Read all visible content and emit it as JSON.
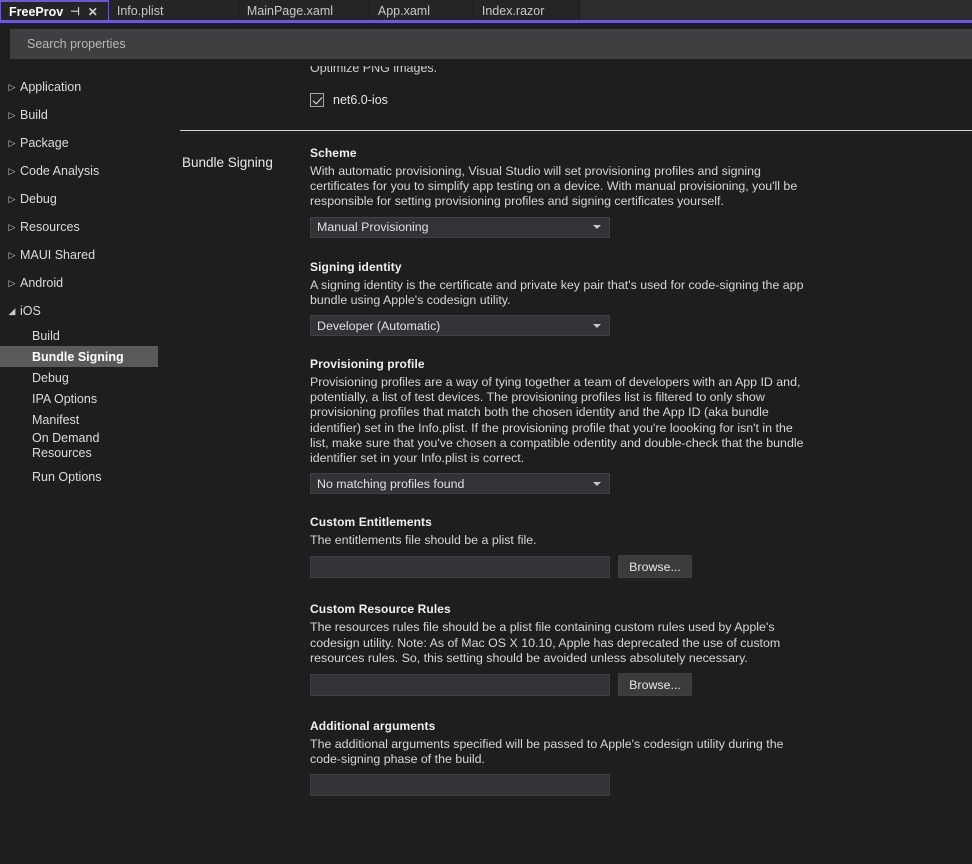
{
  "tabs": [
    {
      "label": "FreeProv",
      "active": true,
      "pin_icon": "pin-icon",
      "close_icon": "close-icon"
    },
    {
      "label": "Info.plist",
      "active": false
    },
    {
      "label": "MainPage.xaml",
      "active": false
    },
    {
      "label": "App.xaml",
      "active": false
    },
    {
      "label": "Index.razor",
      "active": false
    }
  ],
  "search": {
    "placeholder": "Search properties",
    "value": ""
  },
  "sidebar": {
    "items": [
      {
        "label": "Application",
        "expandable": true,
        "expanded": false,
        "level": 0
      },
      {
        "label": "Build",
        "expandable": true,
        "expanded": false,
        "level": 0
      },
      {
        "label": "Package",
        "expandable": true,
        "expanded": false,
        "level": 0
      },
      {
        "label": "Code Analysis",
        "expandable": true,
        "expanded": false,
        "level": 0
      },
      {
        "label": "Debug",
        "expandable": true,
        "expanded": false,
        "level": 0
      },
      {
        "label": "Resources",
        "expandable": true,
        "expanded": false,
        "level": 0
      },
      {
        "label": "MAUI Shared",
        "expandable": true,
        "expanded": false,
        "level": 0
      },
      {
        "label": "Android",
        "expandable": true,
        "expanded": false,
        "level": 0
      },
      {
        "label": "iOS",
        "expandable": true,
        "expanded": true,
        "level": 0
      },
      {
        "label": "Build",
        "level": 1,
        "selected": false
      },
      {
        "label": "Bundle Signing",
        "level": 1,
        "selected": true
      },
      {
        "label": "Debug",
        "level": 1,
        "selected": false
      },
      {
        "label": "IPA Options",
        "level": 1,
        "selected": false
      },
      {
        "label": "Manifest",
        "level": 1,
        "selected": false
      },
      {
        "label": "On Demand Resources",
        "level": 1,
        "selected": false
      },
      {
        "label": "Run Options",
        "level": 1,
        "selected": false
      }
    ]
  },
  "content": {
    "clipped_text": "Optimize PNG images.",
    "framework_checkbox": {
      "label": "net6.0-ios",
      "checked": true
    },
    "section_title": "Bundle Signing",
    "fields": {
      "scheme": {
        "label": "Scheme",
        "description": "With automatic provisioning, Visual Studio will set provisioning profiles and signing certificates for you to simplify app testing on a device. With manual provisioning, you'll be responsible for setting provisioning profiles and signing certificates yourself.",
        "value": "Manual Provisioning"
      },
      "signing_identity": {
        "label": "Signing identity",
        "description": "A signing identity is the certificate and private key pair that's used for code-signing the app bundle using Apple's codesign utility.",
        "value": "Developer (Automatic)"
      },
      "provisioning_profile": {
        "label": "Provisioning profile",
        "description": "Provisioning profiles are a way of tying together a team of developers with an App ID and, potentially, a list of test devices. The provisioning profiles list is filtered to only show provisioning profiles that match both the chosen identity and the App ID (aka bundle identifier) set in the Info.plist. If the provisioning profile that you're loooking for isn't in the list, make sure that you've chosen a compatible odentity and double-check that the bundle identifier set in your Info.plist is correct.",
        "value": "No matching profiles found"
      },
      "custom_entitlements": {
        "label": "Custom Entitlements",
        "description": "The entitlements file should be a plist file.",
        "value": "",
        "browse_label": "Browse..."
      },
      "custom_resource_rules": {
        "label": "Custom Resource Rules",
        "description": "The resources rules file should be a plist file containing custom rules used by Apple's codesign utility. Note: As of Mac OS X 10.10, Apple has deprecated the use of custom resources rules. So, this setting should be avoided unless absolutely necessary.",
        "value": "",
        "browse_label": "Browse..."
      },
      "additional_arguments": {
        "label": "Additional arguments",
        "description": "The additional arguments specified will be passed to Apple's codesign utility during the code-signing phase of the build.",
        "value": ""
      }
    }
  },
  "colors": {
    "accent": "#6a5acd",
    "background": "#1e1e1e",
    "tab_background": "#252526",
    "control": "#333337",
    "selection": "#5a5a5a"
  }
}
